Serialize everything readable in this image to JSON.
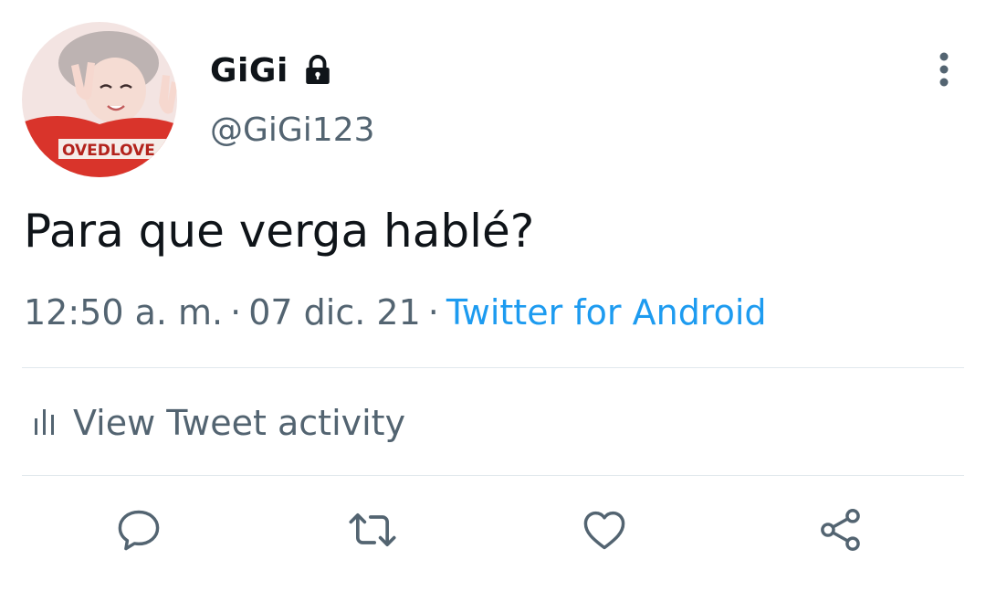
{
  "user": {
    "display_name": "GiGi",
    "handle": "@GiGi123",
    "protected": true,
    "avatar_icon": "profile-photo"
  },
  "tweet": {
    "text": "Para que verga hablé?",
    "time": "12:50 a. m.",
    "separator": "·",
    "date": "07 dic. 21",
    "source": "Twitter for Android"
  },
  "activity": {
    "label": "View Tweet activity",
    "icon": "analytics-icon"
  },
  "actions": {
    "reply_icon": "reply-icon",
    "retweet_icon": "retweet-icon",
    "like_icon": "heart-icon",
    "share_icon": "share-icon"
  },
  "colors": {
    "text_primary": "#0f1419",
    "text_secondary": "#536471",
    "link": "#1d9bf0",
    "divider": "#e1e8ed"
  }
}
